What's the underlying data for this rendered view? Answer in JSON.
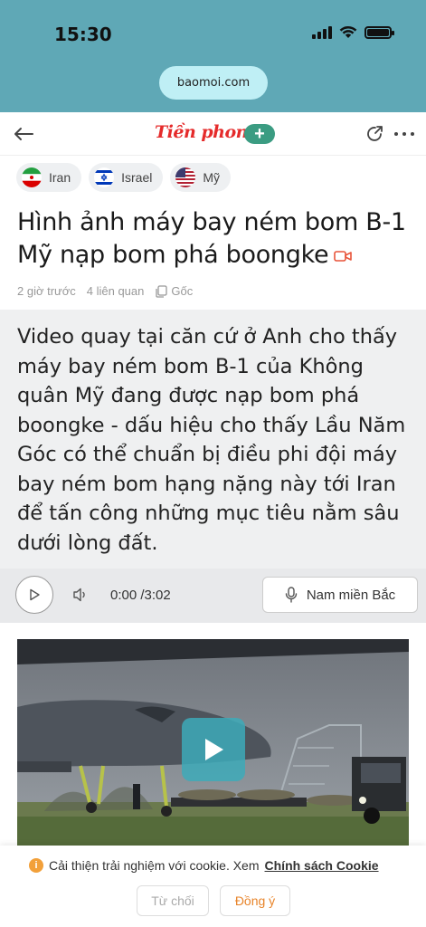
{
  "status_bar": {
    "time": "15:30",
    "icons": [
      "signal-icon",
      "wifi-icon",
      "battery-icon"
    ]
  },
  "browser": {
    "url": "baomoi.com"
  },
  "header": {
    "logo_text": "Tiền phong",
    "logo_color": "#e52b2b",
    "follow_label": "+",
    "icons": [
      "back-arrow-icon",
      "share-icon",
      "more-icon"
    ]
  },
  "tags": [
    {
      "label": "Iran",
      "flag": "iran-flag-icon"
    },
    {
      "label": "Israel",
      "flag": "israel-flag-icon"
    },
    {
      "label": "Mỹ",
      "flag": "us-flag-icon"
    }
  ],
  "article": {
    "title": "Hình ảnh máy bay ném bom B-1 Mỹ nạp bom phá boongke",
    "time_ago": "2 giờ trước",
    "related": "4 liên quan",
    "source_label": "Gốc",
    "sapo": "Video quay tại căn cứ ở Anh cho thấy máy bay ném bom B-1 của Không quân Mỹ đang được nạp bom phá boongke - dấu hiệu cho thấy Lầu Năm Góc có thể chuẩn bị điều phi đội máy bay ném bom hạng nặng này tới Iran để tấn công những mục tiêu nằm sâu dưới lòng đất."
  },
  "audio_player": {
    "time": "0:00 /3:02",
    "voice_label": "Nam miền Bắc"
  },
  "cookie": {
    "message": "Cải thiện trải nghiệm với cookie. Xem",
    "link": "Chính sách Cookie",
    "reject_label": "Từ chối",
    "accept_label": "Đồng ý"
  },
  "colors": {
    "chrome_bg": "#5fa8b6",
    "accent_green": "#3b9c82",
    "accept_orange": "#e8842a",
    "play_overlay": "#3daab9"
  }
}
